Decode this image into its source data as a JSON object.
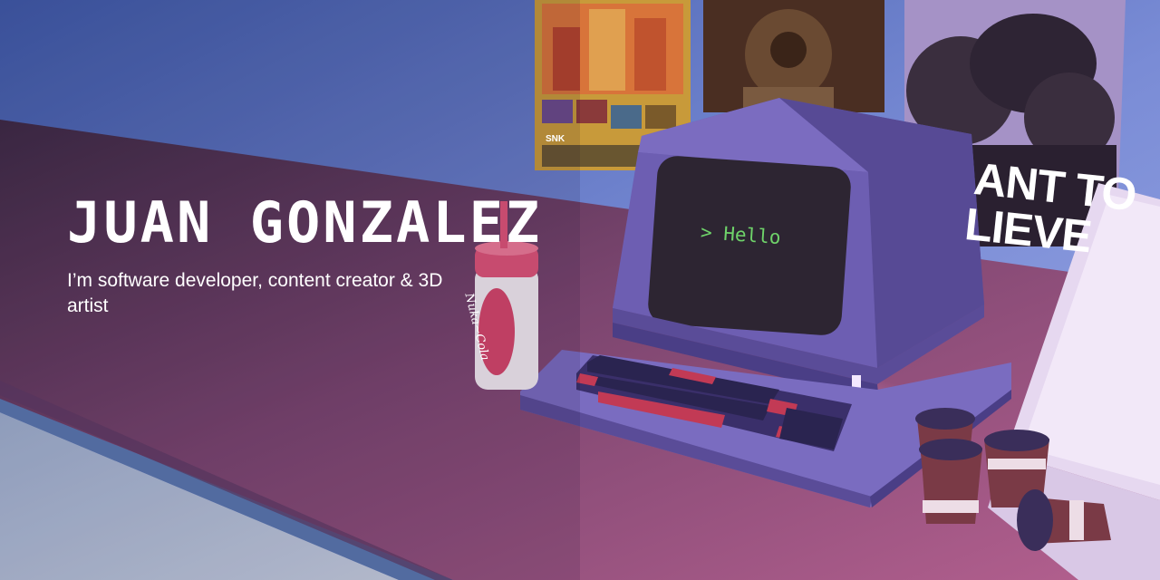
{
  "hero": {
    "name": "JUAN GONZALEZ",
    "tagline": "I’m software developer, content creator & 3D artist"
  },
  "scene": {
    "monitor_text": "> Hello",
    "bottle_label": "Nuka~Cola",
    "poster_text_line1": "ANT TO",
    "poster_text_line2": "LIEVE",
    "poster_logo": "SNK",
    "icons": [
      "retro-computer-icon",
      "keyboard-icon",
      "soda-bottle-icon",
      "coffee-cup-icon",
      "pizza-box-icon",
      "poster-icon"
    ]
  },
  "colors": {
    "wall": "#6d7fd0",
    "desk": "#8a4f86",
    "computer": "#7060b0",
    "screen_text": "#6fd36a",
    "key_red": "#c23a55",
    "bottle_cap": "#e05478"
  }
}
